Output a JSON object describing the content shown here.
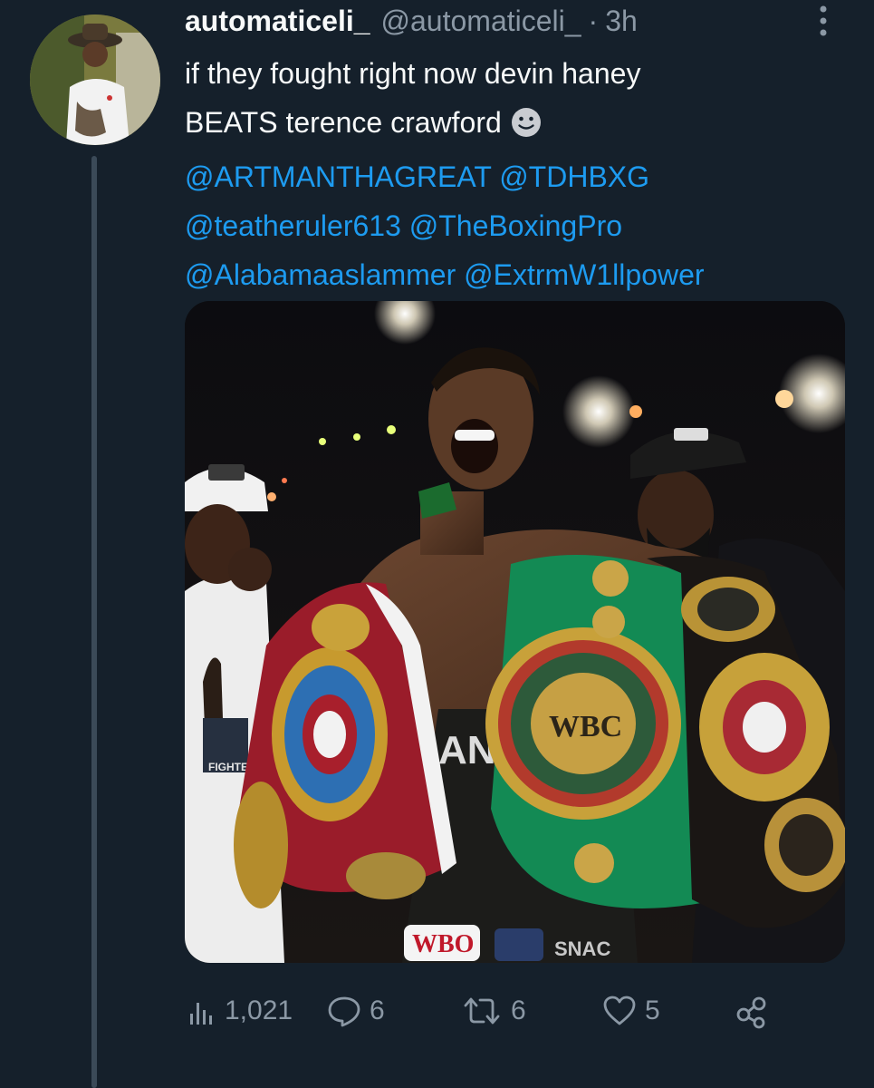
{
  "tweet": {
    "display_name": "automaticeli_",
    "handle": "@automaticeli_",
    "separator": "·",
    "time": "3h",
    "text_line1": "if they fought right now devin haney",
    "text_line2": "BEATS terence crawford",
    "emoji": "slightly-smiling-face",
    "mentions": {
      "m1": "@ARTMANTHAGREAT",
      "m2": "@TDHBXG",
      "m3": "@teatheruler613",
      "m4": "@TheBoxingPro",
      "m5": "@Alabamaaslammer",
      "m6": "@ExtrmW1llpower"
    },
    "media": {
      "description_icon": "photo",
      "visible_text": {
        "belt_wbc": "WBC",
        "trunks_wbo": "WBO",
        "fighters_badge": "FIGHTERS"
      }
    }
  },
  "actions": {
    "views": {
      "icon": "analytics-icon",
      "count": "1,021"
    },
    "replies": {
      "icon": "reply-icon",
      "count": "6"
    },
    "retweets": {
      "icon": "retweet-icon",
      "count": "6"
    },
    "likes": {
      "icon": "heart-icon",
      "count": "5"
    },
    "share": {
      "icon": "share-icon"
    }
  },
  "colors": {
    "background": "#15202b",
    "text": "#f7f9f9",
    "muted": "#8b98a5",
    "link": "#1d9bf0",
    "thread_line": "#3b4a58"
  }
}
